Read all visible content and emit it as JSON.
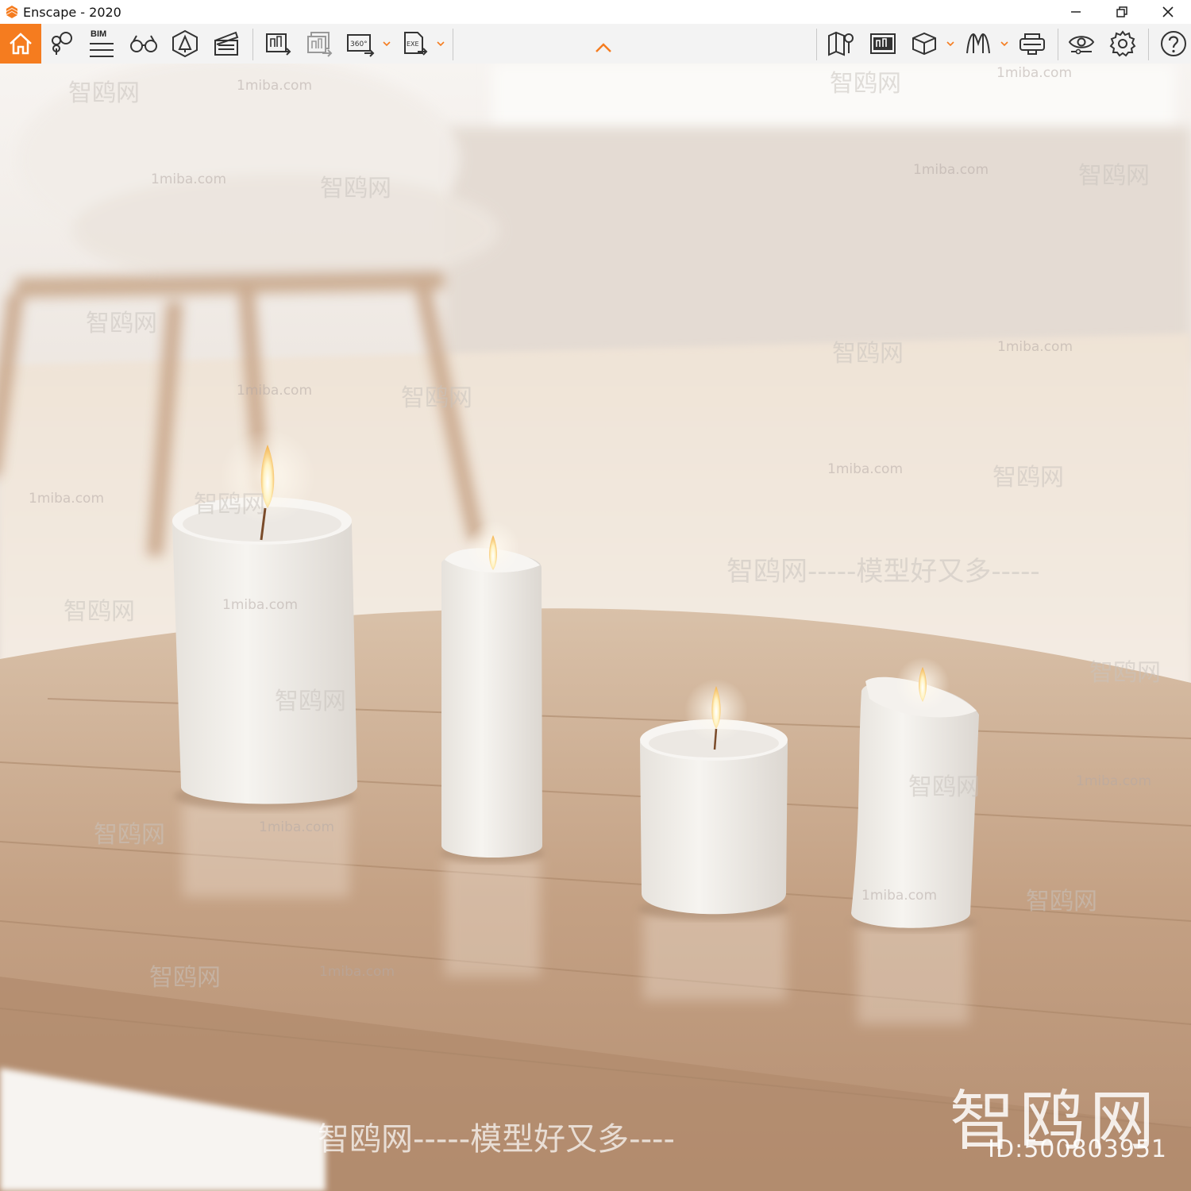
{
  "window": {
    "title": "Enscape - 2020",
    "controls": {
      "minimize": "minimize",
      "restore": "restore",
      "close": "close"
    }
  },
  "toolbar": {
    "bim_label": "BIM",
    "accent_color": "#f57c1f",
    "tools": [
      {
        "icon": "home-icon"
      },
      {
        "icon": "views-pins-icon"
      },
      {
        "icon": "bim-list-icon"
      },
      {
        "icon": "binoculars-icon"
      },
      {
        "icon": "asset-library-icon"
      },
      {
        "icon": "clapperboard-icon"
      },
      {
        "icon": "render-image-icon"
      },
      {
        "icon": "batch-render-icon"
      },
      {
        "icon": "render-360-icon"
      },
      {
        "icon": "export-exe-icon"
      },
      {
        "icon": "map-icon"
      },
      {
        "icon": "minimap-icon"
      },
      {
        "icon": "cube-view-icon"
      },
      {
        "icon": "atmosphere-icon"
      },
      {
        "icon": "vr-headset-icon"
      },
      {
        "icon": "visual-settings-icon"
      },
      {
        "icon": "gear-icon"
      },
      {
        "icon": "help-icon"
      }
    ],
    "collapse_icon": "chevron-up-icon"
  },
  "watermarks": {
    "site": "1miba.com",
    "brand": "智鸥网",
    "slogan": "智鸥网-----模型好又多----",
    "slogan_mid": "智鸥网-----模型好又多-----",
    "big_brand": "智鸥网",
    "id_label": "ID:500803951"
  }
}
